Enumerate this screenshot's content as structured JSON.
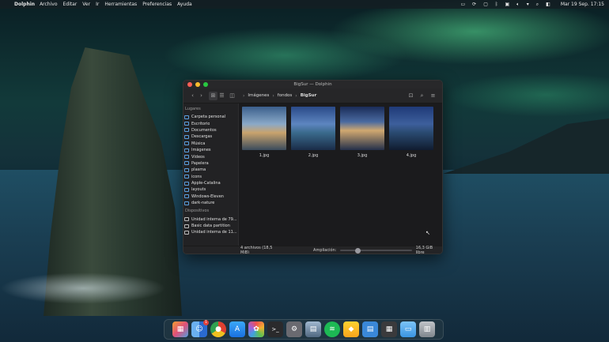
{
  "menubar": {
    "app_name": "Dolphin",
    "items": [
      "Archivo",
      "Editar",
      "Ver",
      "Ir",
      "Herramientas",
      "Preferencias",
      "Ayuda"
    ],
    "clock": "Mar 19 Sep. 17:15"
  },
  "window": {
    "title": "BigSur — Dolphin",
    "breadcrumb": [
      "Imágenes",
      "fondos",
      "BigSur"
    ],
    "sidebar": {
      "places_header": "Lugares",
      "places": [
        "Carpeta personal",
        "Escritorio",
        "Documentos",
        "Descargas",
        "Música",
        "Imágenes",
        "Vídeos",
        "Papelera",
        "plasma",
        "icons",
        "Apple-Catalina",
        "layouts",
        "Windows-Eleven",
        "dark-nature"
      ],
      "devices_header": "Dispositivos",
      "devices": [
        "Unidad interna de 79...",
        "Basic data partition",
        "Unidad interna de 11..."
      ]
    },
    "files": [
      {
        "name": "1.jpg"
      },
      {
        "name": "2.jpg"
      },
      {
        "name": "3.jpg"
      },
      {
        "name": "4.jpg"
      }
    ],
    "status": {
      "count": "4 archivos (18,5 MiB)",
      "zoom_label": "Ampliación:",
      "zoom_level": 0.25,
      "free_space": "16,3 GiB libre"
    }
  },
  "dock": {
    "icons": [
      "launchpad-icon",
      "finder-icon",
      "chrome-icon",
      "app-store-icon",
      "photos-icon",
      "terminal-icon",
      "settings-icon",
      "disk-utility-icon",
      "spotify-icon",
      "sketch-icon",
      "text-editor-icon",
      "calculator-icon",
      "folder-icon",
      "trash-icon"
    ],
    "finder_badge": "1"
  }
}
